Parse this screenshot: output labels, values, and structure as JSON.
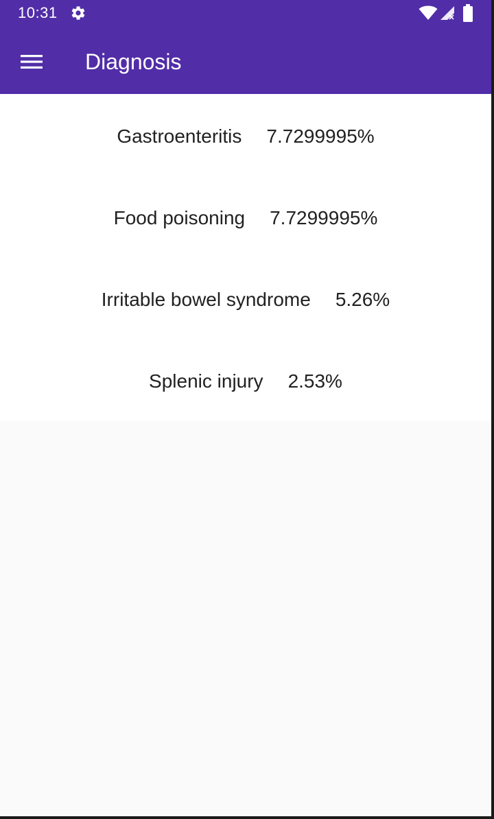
{
  "status_bar": {
    "time": "10:31",
    "icons": [
      "gear-icon",
      "wifi-icon",
      "signal-icon",
      "battery-icon"
    ]
  },
  "app_bar": {
    "title": "Diagnosis",
    "menu_icon": "menu-icon"
  },
  "diagnoses": [
    {
      "name": "Gastroenteritis",
      "probability": "7.7299995%"
    },
    {
      "name": "Food poisoning",
      "probability": "7.7299995%"
    },
    {
      "name": "Irritable bowel syndrome",
      "probability": "5.26%"
    },
    {
      "name": "Splenic injury",
      "probability": "2.53%"
    }
  ],
  "colors": {
    "primary": "#512da8",
    "text": "#212121",
    "background": "#fafafa",
    "card": "#ffffff"
  }
}
